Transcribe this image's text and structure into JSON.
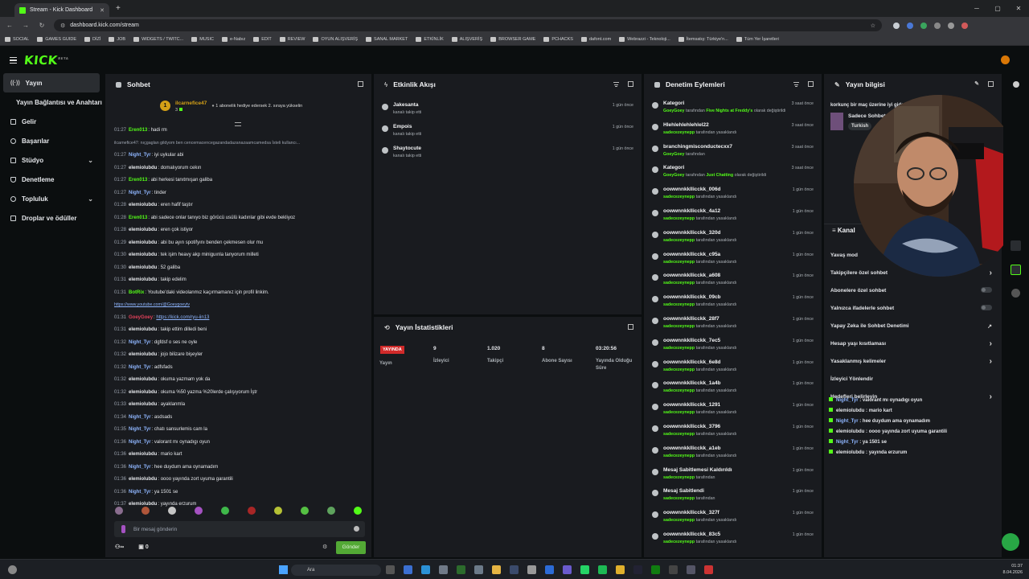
{
  "browser": {
    "tab_title": "Stream - Kick Dashboard",
    "url": "dashboard.kick.com/stream",
    "bookmarks": [
      "SOCIAL",
      "GAMES GUIDE",
      "DİZİ",
      "JOB",
      "WIDGETS / TWITC...",
      "MUSIC",
      "e-Nabız",
      "EDIT",
      "REVIEW",
      "OYUN ALIŞVERİŞ",
      "SANAL MARKET",
      "ETKİNLİK",
      "ALIŞVERİŞ",
      "BROWSER GAME",
      "PCHACKS",
      "dafont.com",
      "Webrazzi - Teknoloji...",
      "İtemsatış: Türkiye'n...",
      "Tüm Yer İşaretleri"
    ]
  },
  "app": {
    "logo": "KICK",
    "logo_badge": "BETA"
  },
  "sidebar": {
    "items": [
      {
        "label": "Yayın"
      },
      {
        "label": "Yayın Bağlantısı ve Anahtarı"
      },
      {
        "label": "Gelir"
      },
      {
        "label": "Başarılar"
      },
      {
        "label": "Stüdyo"
      },
      {
        "label": "Denetleme"
      },
      {
        "label": "Topluluk"
      },
      {
        "label": "Droplar ve ödüller"
      }
    ]
  },
  "chat": {
    "title": "Sohbet",
    "pinned": {
      "badge": "1",
      "name": "ilcarnefice47",
      "count": "3",
      "sub_text": "1 abonelik hediye edersek 2. sıraya yükselin"
    },
    "messages": [
      {
        "time": "01:27",
        "user": "Eren013",
        "color": "#53fc18",
        "text": "hadi rm"
      },
      {
        "time": "",
        "user": "",
        "color": "#9ca3af",
        "text": "ilcarnefice47: nıçgaglan gildyom ben cencemacencegazandadazanazaamcamedsa İsteli kullancı..."
      },
      {
        "time": "01:27",
        "user": "Night_Tyr",
        "color": "#8fb6ff",
        "text": "iyi uykular abi"
      },
      {
        "time": "01:27",
        "user": "elemiolubdu",
        "color": "#e5e7eb",
        "text": "domalıyorum cekın"
      },
      {
        "time": "01:27",
        "user": "Eren013",
        "color": "#53fc18",
        "text": "abi herkesi tanıtmışan galiba"
      },
      {
        "time": "01:27",
        "user": "Night_Tyr",
        "color": "#8fb6ff",
        "text": "tinder"
      },
      {
        "time": "01:28",
        "user": "elemiolubdu",
        "color": "#e5e7eb",
        "text": "eren hafif taştır"
      },
      {
        "time": "01:28",
        "user": "Eren013",
        "color": "#53fc18",
        "text": "abi sadece onlar tanıyo biz görücü usülü kadınlar gibi evde bekliyoz"
      },
      {
        "time": "01:28",
        "user": "elemiolubdu",
        "color": "#e5e7eb",
        "text": "eren çok istiyor"
      },
      {
        "time": "01:29",
        "user": "elemiolubdu",
        "color": "#e5e7eb",
        "text": "abi bu ayın spotifyını benden çekmesen olur mu"
      },
      {
        "time": "01:30",
        "user": "elemiolubdu",
        "color": "#e5e7eb",
        "text": "tek işim heavy akp miniguınla tanyorum milleti"
      },
      {
        "time": "01:30",
        "user": "elemiolubdu",
        "color": "#e5e7eb",
        "text": "52 galiba"
      },
      {
        "time": "01:31",
        "user": "elemiolubdu",
        "color": "#e5e7eb",
        "text": "takip edelim"
      },
      {
        "time": "01:31",
        "user": "BotRix",
        "color": "#53fc18",
        "text": "Youtube'daki videolanmız kaçırmamanız için profil linkim."
      },
      {
        "time": "",
        "user": "",
        "color": "#8fb6ff",
        "text": "https://www.youtube.com/@Goeygoeytv"
      },
      {
        "time": "01:31",
        "user": "GoeyGoey",
        "color": "#e0405a",
        "text": "https://kick.com/ryu-iin13"
      },
      {
        "time": "01:31",
        "user": "elemiolubdu",
        "color": "#e5e7eb",
        "text": "takip ettim dilledi beni"
      },
      {
        "time": "01:32",
        "user": "Night_Tyr",
        "color": "#8fb6ff",
        "text": "dgfdsf o ses ne oyle"
      },
      {
        "time": "01:32",
        "user": "elemiolubdu",
        "color": "#e5e7eb",
        "text": "jojo bilizare bişeyler"
      },
      {
        "time": "01:32",
        "user": "Night_Tyr",
        "color": "#8fb6ff",
        "text": "adfsfads"
      },
      {
        "time": "01:32",
        "user": "elemiolubdu",
        "color": "#e5e7eb",
        "text": "okuma yazmam yok da"
      },
      {
        "time": "01:32",
        "user": "elemiolubdu",
        "color": "#e5e7eb",
        "text": "okuma %50 yazma %20lerde çalışıyorum İştr"
      },
      {
        "time": "01:33",
        "user": "elemiolubdu",
        "color": "#e5e7eb",
        "text": "ayaklanmla"
      },
      {
        "time": "01:34",
        "user": "Night_Tyr",
        "color": "#8fb6ff",
        "text": "asdsads"
      },
      {
        "time": "01:35",
        "user": "Night_Tyr",
        "color": "#8fb6ff",
        "text": "chatı sansurlemis cam la"
      },
      {
        "time": "01:36",
        "user": "Night_Tyr",
        "color": "#8fb6ff",
        "text": "valorant mı oynadıgı oyun"
      },
      {
        "time": "01:36",
        "user": "elemiolubdu",
        "color": "#e5e7eb",
        "text": "mario kart"
      },
      {
        "time": "01:36",
        "user": "Night_Tyr",
        "color": "#8fb6ff",
        "text": "hee duydum ama oynamadım"
      },
      {
        "time": "01:36",
        "user": "elemiolubdu",
        "color": "#e5e7eb",
        "text": "oooo yayında zort uyuma garantili"
      },
      {
        "time": "01:36",
        "user": "Night_Tyr",
        "color": "#8fb6ff",
        "text": "ya 1501 se"
      },
      {
        "time": "01:37",
        "user": "elemiolubdu",
        "color": "#e5e7eb",
        "text": "yayında erzurum"
      }
    ],
    "input_placeholder": "Bir mesaj gönderin",
    "viewers_icon_text": "∞",
    "points": "0",
    "send_label": "Gönder"
  },
  "activity": {
    "title": "Etkinlik Akışı",
    "items": [
      {
        "name": "Jakesanta",
        "sub": "kanalı takip etti",
        "time": "1 gün önce"
      },
      {
        "name": "Empois",
        "sub": "kanalı takip etti",
        "time": "1 gün önce"
      },
      {
        "name": "Shaytocute",
        "sub": "kanalı takip etti",
        "time": "1 gün önce"
      }
    ]
  },
  "stats": {
    "title": "Yayın İstatistikleri",
    "live_badge": "YAYINDA",
    "status_label": "Yayın",
    "viewers": "9",
    "viewers_label": "İzleyici",
    "followers": "1.020",
    "followers_label": "Takipçi",
    "subs": "8",
    "subs_label": "Abone Sayısı",
    "uptime": "03:20:56",
    "uptime_label": "Yayında Olduğu Süre"
  },
  "modlog": {
    "title": "Denetim Eylemleri",
    "items": [
      {
        "name": "Kategori",
        "pre": "GoeyGoey",
        "mid": " tarafından ",
        "hl": "Five Nights at Freddy's",
        "post": " olarak değiştirildi",
        "time": "3 saat önce"
      },
      {
        "name": "Hlehlehlehlehlel22",
        "pre": "sadecezeynepp",
        "mid": " tarafından yasaklandı",
        "hl": "",
        "post": "",
        "time": "3 saat önce"
      },
      {
        "name": "branchingmisconductecxx7",
        "pre": "GoeyGoey",
        "mid": " tarafından",
        "hl": "",
        "post": "",
        "time": "3 saat önce"
      },
      {
        "name": "Kategori",
        "pre": "GoeyGoey",
        "mid": " tarafından ",
        "hl": "Just Chatting",
        "post": " olarak değiştirildi",
        "time": "3 saat önce"
      },
      {
        "name": "oowwnnkkllicckk_006d",
        "pre": "sadecezeynepp",
        "mid": " tarafından yasaklandı",
        "hl": "",
        "post": "",
        "time": "1 gün önce"
      },
      {
        "name": "oowwnnkkllicckk_4a12",
        "pre": "sadecezeynepp",
        "mid": " tarafından yasaklandı",
        "hl": "",
        "post": "",
        "time": "1 gün önce"
      },
      {
        "name": "oowwnnkkllicckk_320d",
        "pre": "sadecezeynepp",
        "mid": " tarafından yasaklandı",
        "hl": "",
        "post": "",
        "time": "1 gün önce"
      },
      {
        "name": "oowwnnkkllicckk_c95a",
        "pre": "sadecezeynepp",
        "mid": " tarafından yasaklandı",
        "hl": "",
        "post": "",
        "time": "1 gün önce"
      },
      {
        "name": "oowwnnkkllicckk_a608",
        "pre": "sadecezeynepp",
        "mid": " tarafından yasaklandı",
        "hl": "",
        "post": "",
        "time": "1 gün önce"
      },
      {
        "name": "oowwnnkkllicckk_09cb",
        "pre": "sadecezeynepp",
        "mid": " tarafından yasaklandı",
        "hl": "",
        "post": "",
        "time": "1 gün önce"
      },
      {
        "name": "oowwnnkkllicckk_28f7",
        "pre": "sadecezeynepp",
        "mid": " tarafından yasaklandı",
        "hl": "",
        "post": "",
        "time": "1 gün önce"
      },
      {
        "name": "oowwnnkkllicckk_7ec5",
        "pre": "sadecezeynepp",
        "mid": " tarafından yasaklandı",
        "hl": "",
        "post": "",
        "time": "1 gün önce"
      },
      {
        "name": "oowwnnkkllicckk_6e8d",
        "pre": "sadecezeynepp",
        "mid": " tarafından yasaklandı",
        "hl": "",
        "post": "",
        "time": "1 gün önce"
      },
      {
        "name": "oowwnnkkllicckk_1a4b",
        "pre": "sadecezeynepp",
        "mid": " tarafından yasaklandı",
        "hl": "",
        "post": "",
        "time": "1 gün önce"
      },
      {
        "name": "oowwnnkkllicckk_1291",
        "pre": "sadecezeynepp",
        "mid": " tarafından yasaklandı",
        "hl": "",
        "post": "",
        "time": "1 gün önce"
      },
      {
        "name": "oowwnnkkllicckk_3796",
        "pre": "sadecezeynepp",
        "mid": " tarafından yasaklandı",
        "hl": "",
        "post": "",
        "time": "1 gün önce"
      },
      {
        "name": "oowwnnkkllicckk_a1eb",
        "pre": "sadecezeynepp",
        "mid": " tarafından yasaklandı",
        "hl": "",
        "post": "",
        "time": "1 gün önce"
      },
      {
        "name": "Mesaj Sabitlemesi Kaldırıldı",
        "pre": "sadecezeynepp",
        "mid": " tarafından",
        "hl": "",
        "post": "",
        "time": "1 gün önce"
      },
      {
        "name": "Mesaj Sabitlendi",
        "pre": "sadecezeynepp",
        "mid": " tarafından",
        "hl": "",
        "post": "",
        "time": "1 gün önce"
      },
      {
        "name": "oowwnnkkllicckk_327f",
        "pre": "sadecezeynepp",
        "mid": " tarafından yasaklandı",
        "hl": "",
        "post": "",
        "time": "1 gün önce"
      },
      {
        "name": "oowwnnkkllicckk_83c5",
        "pre": "sadecezeynepp",
        "mid": " tarafından yasaklandı",
        "hl": "",
        "post": "",
        "time": "1 gün önce"
      }
    ]
  },
  "info": {
    "title": "Yayın bilgisi",
    "stream_title": "korkunç bir maç üzerine iyi gider",
    "category": "Sadece Sohbet",
    "tag": "Turkish",
    "settings_title": "Kanal",
    "settings": [
      {
        "label": "Yavaş mod",
        "kind": "none"
      },
      {
        "label": "Takipçilere özel sohbet",
        "kind": "arrow"
      },
      {
        "label": "Abonelere özel sohbet",
        "kind": "toggle"
      },
      {
        "label": "Yalnızca ifadelerle sohbet",
        "kind": "toggle"
      },
      {
        "label": "Yapay Zeka ile Sohbet Denetimi",
        "kind": "ext"
      },
      {
        "label": "Hesap yaşı kısıtlaması",
        "kind": "arrow"
      },
      {
        "label": "Yasaklanmış kelimeler",
        "kind": "arrow"
      },
      {
        "label": "İzleyici Yönlendir",
        "kind": "none"
      },
      {
        "label": "Hedefleri belirleyin",
        "kind": "arrow"
      }
    ],
    "mini_chat": [
      {
        "user": "Night_Tyr",
        "color": "#8fb6ff",
        "text": "valorant mı oynadıgı oyun"
      },
      {
        "user": "elemiolubdu",
        "color": "#e5e7eb",
        "text": "mario kart"
      },
      {
        "user": "Night_Tyr",
        "color": "#8fb6ff",
        "text": "hee duydum ama oynamadım"
      },
      {
        "user": "elemiolubdu",
        "color": "#e5e7eb",
        "text": "oooo yayında zort uyuma garantili"
      },
      {
        "user": "Night_Tyr",
        "color": "#8fb6ff",
        "text": "ya 1501 se"
      },
      {
        "user": "elemiolubdu",
        "color": "#e5e7eb",
        "text": "yayında erzurum"
      }
    ]
  },
  "taskbar": {
    "search_placeholder": "Ara",
    "time": "01:37",
    "date": "8.04.2026"
  }
}
